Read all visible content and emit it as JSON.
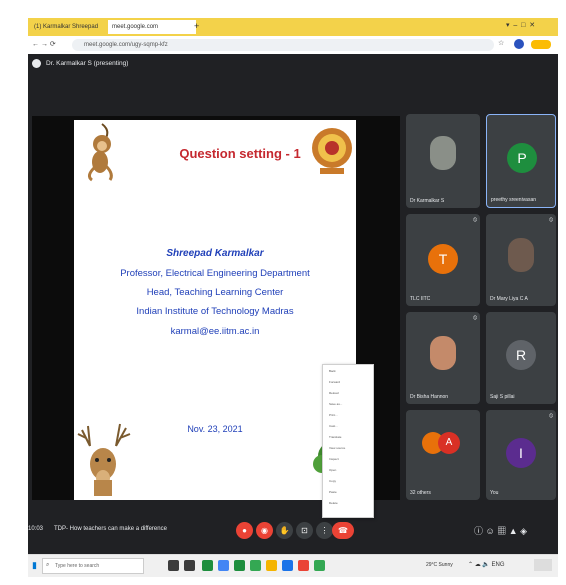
{
  "browser": {
    "tabs": [
      "(1) Karmalkar Shreepad",
      "meet.google.com"
    ],
    "address": "meet.google.com/ugy-sqmp-kfz"
  },
  "meet": {
    "presenter_label": "Dr. Karmalkar S (presenting)",
    "slide": {
      "title": "Question setting - 1",
      "name": "Shreepad Karmalkar",
      "line1": "Professor, Electrical Engineering Department",
      "line2": "Head, Teaching Learning Center",
      "line3": "Indian Institute of Technology Madras",
      "line4": "karmal@ee.iitm.ac.in",
      "date": "Nov. 23, 2021"
    },
    "context_menu": [
      "Back",
      "Forward",
      "Reload",
      "Save as...",
      "Print...",
      "Cast...",
      "Translate",
      "View source",
      "Inspect",
      "Open",
      "Copy",
      "Paste",
      "Delete"
    ],
    "participants": [
      {
        "name": "Dr Karmalkar S",
        "initial": "",
        "type": "photo"
      },
      {
        "name": "preethy sreenivasan",
        "initial": "P",
        "type": "avatar",
        "color": "#1e8e3e"
      },
      {
        "name": "TLC IITC",
        "initial": "T",
        "type": "avatar",
        "color": "#e8710a"
      },
      {
        "name": "Dr Mary Liya C A",
        "initial": "",
        "type": "photo"
      },
      {
        "name": "Dr Bisha Hannon",
        "initial": "",
        "type": "photo"
      },
      {
        "name": "Saji S pillai",
        "initial": "R",
        "type": "avatar",
        "color": "#5f6368"
      },
      {
        "name": "32 others",
        "initial": "A",
        "type": "avatar",
        "color": "#d93025"
      },
      {
        "name": "You",
        "initial": "I",
        "type": "avatar",
        "color": "#5b2c8f"
      }
    ],
    "time": "10:03",
    "meeting_title": "TDP- How teachers can make a difference"
  },
  "taskbar": {
    "search_placeholder": "Type here to search",
    "tray_text": "29°C Sunny"
  },
  "colors": {
    "tab_bar": "#f3d24a",
    "meet_bg": "#202124",
    "end_call": "#ea4335",
    "slide_title": "#c5282f",
    "slide_blue": "#1f3fb8"
  }
}
